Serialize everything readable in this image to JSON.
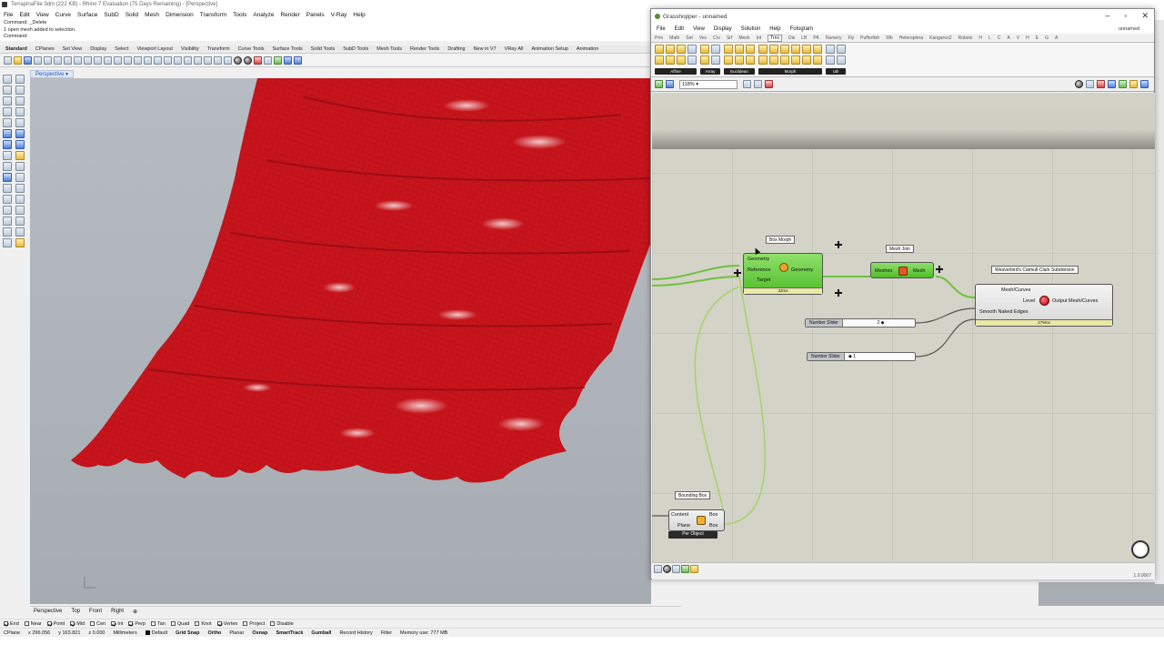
{
  "rhino": {
    "title": "TerrapinaFile 3dm (222 KB) - Rhino 7 Evaluation (75 Days Remaining) - [Perspective]",
    "menu": [
      "File",
      "Edit",
      "View",
      "Curve",
      "Surface",
      "SubD",
      "Solid",
      "Mesh",
      "Dimension",
      "Transform",
      "Tools",
      "Analyze",
      "Render",
      "Panels",
      "V-Ray",
      "Help"
    ],
    "command_lines": [
      "Command: _Delete",
      "1 open mesh added to selection.",
      "Command:"
    ],
    "toolbar_tabs": [
      "Standard",
      "CPlanes",
      "Set View",
      "Display",
      "Select",
      "Viewport Layout",
      "Visibility",
      "Transform",
      "Curve Tools",
      "Surface Tools",
      "Solid Tools",
      "SubD Tools",
      "Mesh Tools",
      "Render Tools",
      "Drafting",
      "New in V7",
      "VRay All",
      "Animation Setup",
      "Animation"
    ],
    "viewport_label": "Perspective",
    "viewport_tabs": [
      "Perspective",
      "Top",
      "Front",
      "Right"
    ],
    "osnaps": [
      {
        "label": "End",
        "on": true
      },
      {
        "label": "Near",
        "on": false
      },
      {
        "label": "Point",
        "on": true
      },
      {
        "label": "Mid",
        "on": true
      },
      {
        "label": "Cen",
        "on": false
      },
      {
        "label": "Int",
        "on": true
      },
      {
        "label": "Perp",
        "on": true
      },
      {
        "label": "Tan",
        "on": false
      },
      {
        "label": "Quad",
        "on": false
      },
      {
        "label": "Knot",
        "on": false
      },
      {
        "label": "Vertex",
        "on": true
      },
      {
        "label": "Project",
        "on": false
      },
      {
        "label": "Disable",
        "on": false
      }
    ],
    "status": {
      "cplane": "CPlane",
      "x": "x 296.056",
      "y": "y 163.821",
      "z": "z 0.000",
      "units": "Millimeters",
      "layer": "Default",
      "grid_snap": "Grid Snap",
      "ortho": "Ortho",
      "planar": "Planar",
      "osnap": "Osnap",
      "smarttrack": "SmartTrack",
      "gumball": "Gumball",
      "record_history": "Record History",
      "filter": "Filter",
      "memory": "Memory use: 777 MB"
    }
  },
  "gh": {
    "title": "Grasshopper - unnamed",
    "menu": [
      "File",
      "Edit",
      "View",
      "Display",
      "Solution",
      "Help",
      "Fologram"
    ],
    "doc_name": "unnamed",
    "tabs": [
      "Prm",
      "Math",
      "Set",
      "Vec",
      "Crv",
      "Srf",
      "Mesh",
      "Int",
      "Trns",
      "Dis",
      "LB",
      "PK",
      "Nursery",
      "Fly",
      "Pufferfish",
      "Wb",
      "Heteroptera",
      "Kangaroo2",
      "Robots",
      "H",
      "L",
      "C",
      "A",
      "V",
      "H",
      "E",
      "G",
      "A"
    ],
    "active_tab": "Trns",
    "ribbon_groups": [
      "Affine",
      "Array",
      "Euclidean",
      "Morph",
      "Util"
    ],
    "zoom": "118%",
    "status_right": "1.0.0007",
    "components": {
      "box_morph": {
        "title": "Box Morph",
        "inputs": [
          "Geometry",
          "Reference",
          "Target"
        ],
        "output": "Geometry",
        "timer": "32ms"
      },
      "mesh_join": {
        "title": "Mesh Join",
        "input": "Meshes",
        "output": "Mesh"
      },
      "catmull": {
        "title": "Weaverbird's Catmull-Clark Subdivision",
        "inputs": [
          "Mesh/Curves",
          "Level",
          "Smooth Naked Edges"
        ],
        "output": "Output Mesh/Curves",
        "timer": "279ms"
      },
      "bounding_box": {
        "title": "Bounding Box",
        "inputs": [
          "Content",
          "Plane"
        ],
        "outputs": [
          "Box",
          "Box"
        ],
        "mode": "Per Object"
      }
    },
    "sliders": [
      {
        "name": "Number Slider",
        "value": "2 ◆"
      },
      {
        "name": "Number Slider",
        "value": "◆ 1"
      }
    ]
  },
  "colors": {
    "mesh_red": "#c8141c",
    "gh_green": "#5cc232",
    "canvas": "#d4d3c8"
  }
}
